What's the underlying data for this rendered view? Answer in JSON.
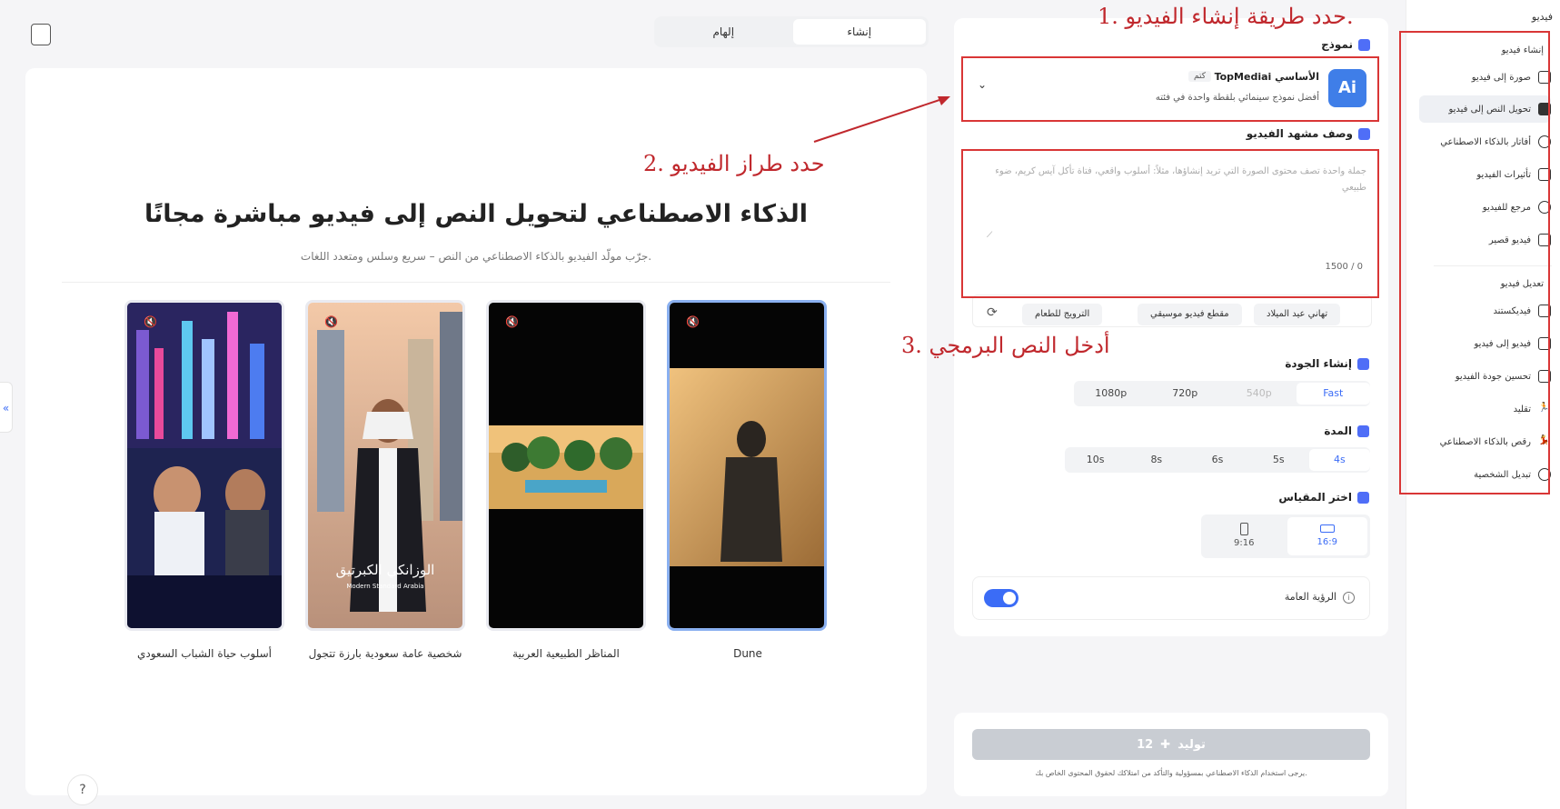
{
  "annotations": {
    "step1": "1. حدد طريقة إنشاء الفيديو.",
    "step2": "2. حدد طراز الفيديو",
    "step3": "3. أدخل النص البرمجي"
  },
  "top_tabs": [
    "إلهام",
    "إنشاء"
  ],
  "sidebar": {
    "header": "فيديو",
    "group1_title": "إنشاء فيديو",
    "group1": [
      {
        "label": "صورة إلى فيديو",
        "icon": "image-to-video-icon"
      },
      {
        "label": "تحويل النص إلى فيديو",
        "icon": "text-to-video-icon"
      },
      {
        "label": "أفاتار بالذكاء الاصطناعي",
        "icon": "avatar-icon"
      },
      {
        "label": "تأثيرات الفيديو",
        "icon": "magic-wand-icon"
      },
      {
        "label": "مرجع للفيديو",
        "icon": "reference-icon"
      },
      {
        "label": "فيديو قصير",
        "icon": "short-video-icon"
      }
    ],
    "group2_title": "تعديل فيديو",
    "group2": [
      {
        "label": "فيديكستند",
        "icon": "extend-icon"
      },
      {
        "label": "فيديو إلى فيديو",
        "icon": "video-to-video-icon"
      },
      {
        "label": "تحسين جودة الفيديو",
        "icon": "enhance-icon"
      },
      {
        "label": "تقليد",
        "icon": "mimic-icon"
      },
      {
        "label": "رقص بالذكاء الاصطناعي",
        "icon": "dance-icon"
      },
      {
        "label": "تبديل الشخصية",
        "icon": "swap-character-icon"
      }
    ]
  },
  "model": {
    "section_title": "نموذج",
    "name": "TopMediai الأساسي",
    "badge": "كتم",
    "description": "أفضل نموذج سينمائي بلقطة واحدة في فئته"
  },
  "scene": {
    "section_title": "وصف مشهد الفيديو",
    "placeholder": "جملة واحدة تصف محتوى الصورة التي تريد إنشاؤها، مثلاً: أسلوب واقعي، فتاة تأكل آيس كريم، ضوء طبيعي",
    "counter": "1500 / 0"
  },
  "chips": [
    "تهاني عيد الميلاد",
    "مقطع فيديو موسيقي",
    "الترويج للطعام"
  ],
  "quality": {
    "section_title": "إنشاء الجودة",
    "options": [
      "1080p",
      "720p",
      "540p",
      "Fast"
    ],
    "selected": "Fast",
    "disabled": "540p"
  },
  "duration": {
    "section_title": "المدة",
    "options": [
      "10s",
      "8s",
      "6s",
      "5s",
      "4s"
    ],
    "selected": "4s"
  },
  "ratio": {
    "section_title": "اختر المقياس",
    "options": [
      "9:16",
      "16:9"
    ],
    "selected": "16:9"
  },
  "visibility": {
    "label": "الرؤية العامة",
    "enabled": true
  },
  "generate": {
    "label": "توليد",
    "cost": "12",
    "disclaimer": "يرجى استخدام الذكاء الاصطناعي بمسؤولية والتأكد من امتلاكك لحقوق المحتوى الخاص بك."
  },
  "hero": {
    "title": "الذكاء الاصطناعي لتحويل النص إلى فيديو مباشرة مجانًا",
    "subtitle": "جرّب مولّد الفيديو بالذكاء الاصطناعي من النص – سريع وسلس ومتعدد اللغات."
  },
  "cards": [
    {
      "label": "أسلوب حياة الشباب السعودي"
    },
    {
      "label": "شخصية عامة سعودية بارزة تتجول",
      "overlay_title": "الوزانكي الكبرتيق",
      "overlay_sub": "Modern Standard Arabia"
    },
    {
      "label": "المناظر الطبيعية العربية"
    },
    {
      "label": "Dune"
    }
  ],
  "colors": {
    "accent": "#3b6cf6",
    "annotation": "#c0282d"
  }
}
